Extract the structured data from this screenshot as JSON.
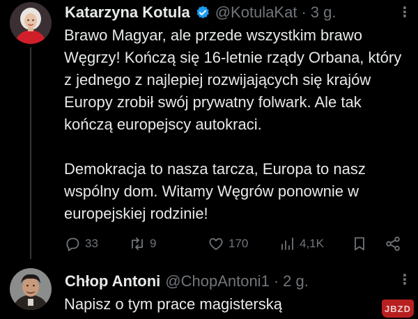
{
  "tweet1": {
    "author_name": "Katarzyna Kotula",
    "handle": "@KotulaKat",
    "separator": "·",
    "time": "3 g.",
    "verified": true,
    "paragraph1": "Brawo Magyar, ale przede wszystkim brawo Węgrzy! Kończą się 16-letnie rządy Orbana, który z jednego z najlepiej rozwijających się krajów Europy zrobił swój prywatny folwark. Ale tak kończą europejscy autokraci.",
    "paragraph2": "Demokracja to nasza tarcza, Europa to nasz wspólny dom. Witamy Węgrów ponownie w europejskiej rodzinie!",
    "stats": {
      "replies": "33",
      "reposts": "9",
      "likes": "170",
      "views": "4,1K"
    }
  },
  "tweet2": {
    "author_name": "Chłop Antoni",
    "handle": "@ChopAntoni1",
    "separator": "·",
    "time": "2 g.",
    "text": "Napisz o tym prace magisterską"
  },
  "more_glyph": "⋮",
  "watermark": "JBZD",
  "icons": [
    "reply-icon",
    "repost-icon",
    "like-icon",
    "views-icon",
    "bookmark-icon",
    "share-icon",
    "verified-badge-icon"
  ],
  "colors": {
    "background": "#000000",
    "text": "#e7e9ea",
    "muted": "#71767b",
    "verified": "#1d9bf0",
    "thread_line": "#333639"
  }
}
